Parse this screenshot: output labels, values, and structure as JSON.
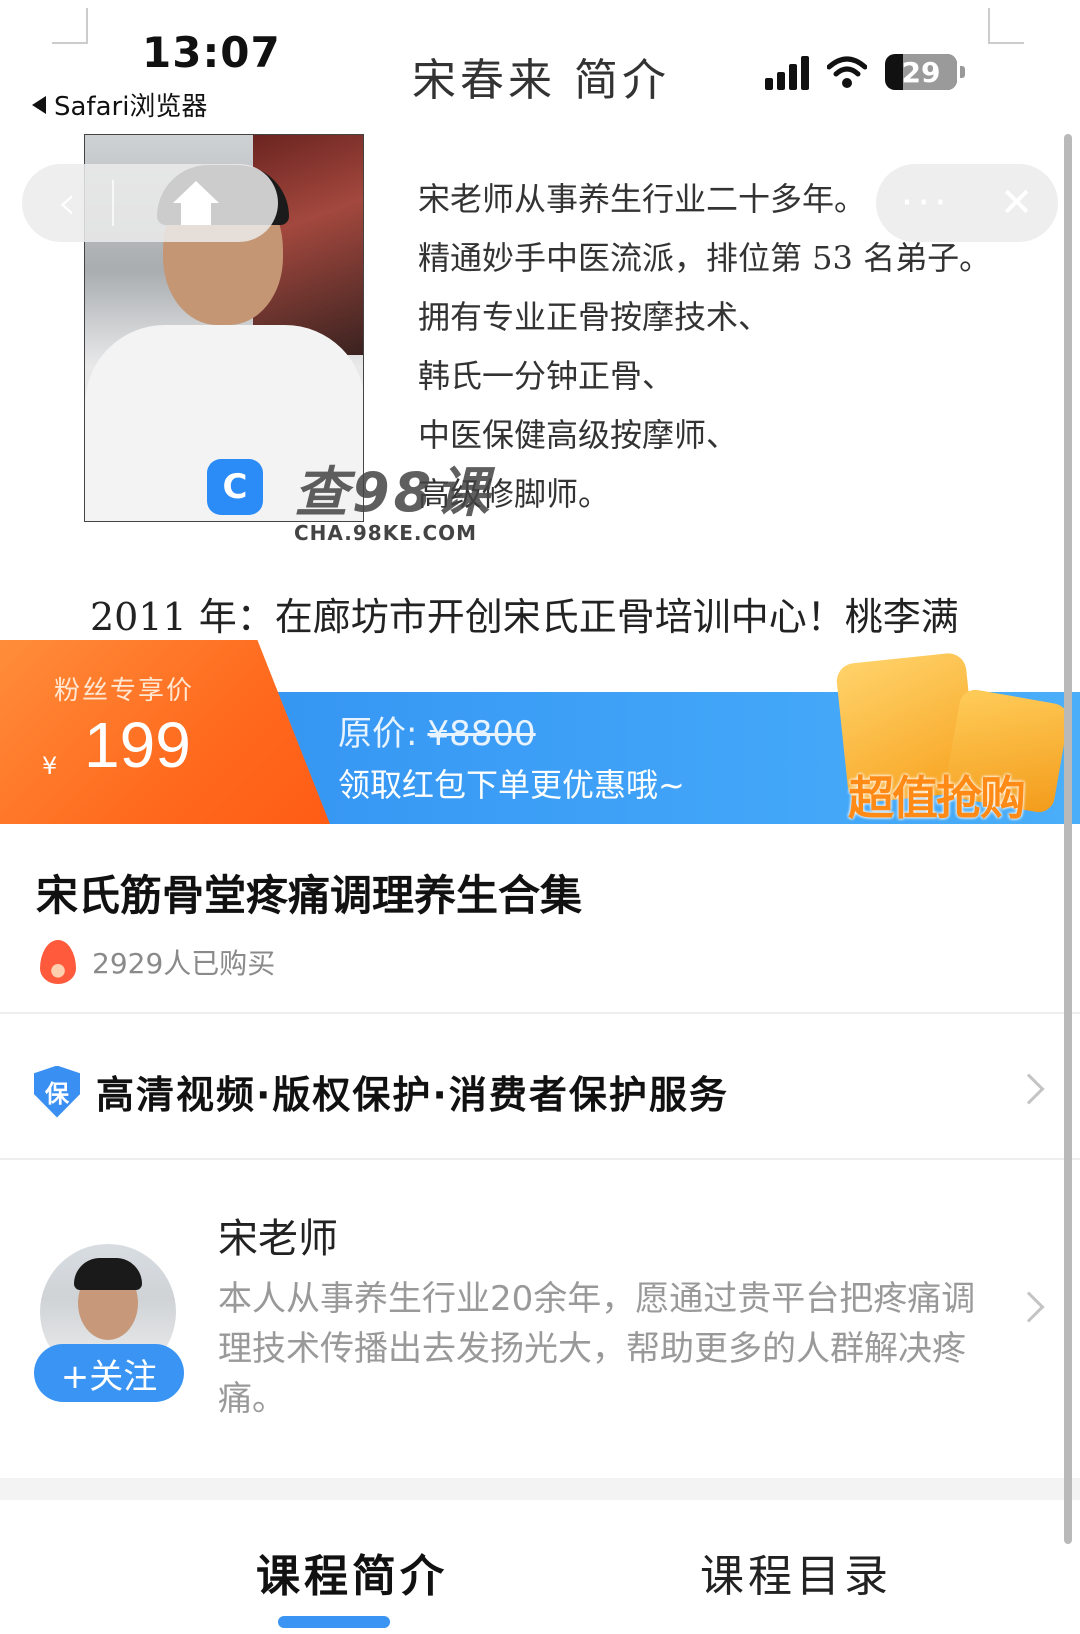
{
  "status_bar": {
    "time": "13:07",
    "back_app": "Safari浏览器",
    "battery": "29"
  },
  "page_title": "宋春来 简介",
  "intro": {
    "lines": [
      "宋老师从事养生行业二十多年。",
      "精通妙手中医流派，排位第 53 名弟子。",
      "拥有专业正骨按摩技术、",
      "韩氏一分钟正骨、",
      "中医保健高级按摩师、",
      "高级修脚师。"
    ],
    "watermark_big": "查98课",
    "watermark_small": "CHA.98KE.COM",
    "year_line": "2011 年：在廊坊市开创宋氏正骨培训中心！桃李满"
  },
  "nav": {
    "back_glyph": "‹",
    "menu_glyph": "···",
    "close_glyph": "✕"
  },
  "price_banner": {
    "fan_label": "粉丝专享价",
    "currency": "¥",
    "price": "199",
    "original_label": "原价:",
    "original_price": "¥8800",
    "promo_text": "领取红包下单更优惠哦~",
    "rush_label": "超值抢购"
  },
  "course": {
    "title": "宋氏筋骨堂疼痛调理养生合集",
    "bought": "2929人已购买"
  },
  "service": {
    "badge": "保",
    "text": "高清视频·版权保护·消费者保护服务"
  },
  "teacher": {
    "name": "宋老师",
    "description": "本人从事养生行业20余年，愿通过贵平台把疼痛调理技术传播出去发扬光大，帮助更多的人群解决疼痛。",
    "follow_label": "+关注"
  },
  "tabs": [
    {
      "label": "课程简介",
      "active": true
    },
    {
      "label": "课程目录",
      "active": false
    }
  ],
  "colors": {
    "accent_blue": "#3a94f3",
    "price_orange": "#ff6a1e"
  }
}
